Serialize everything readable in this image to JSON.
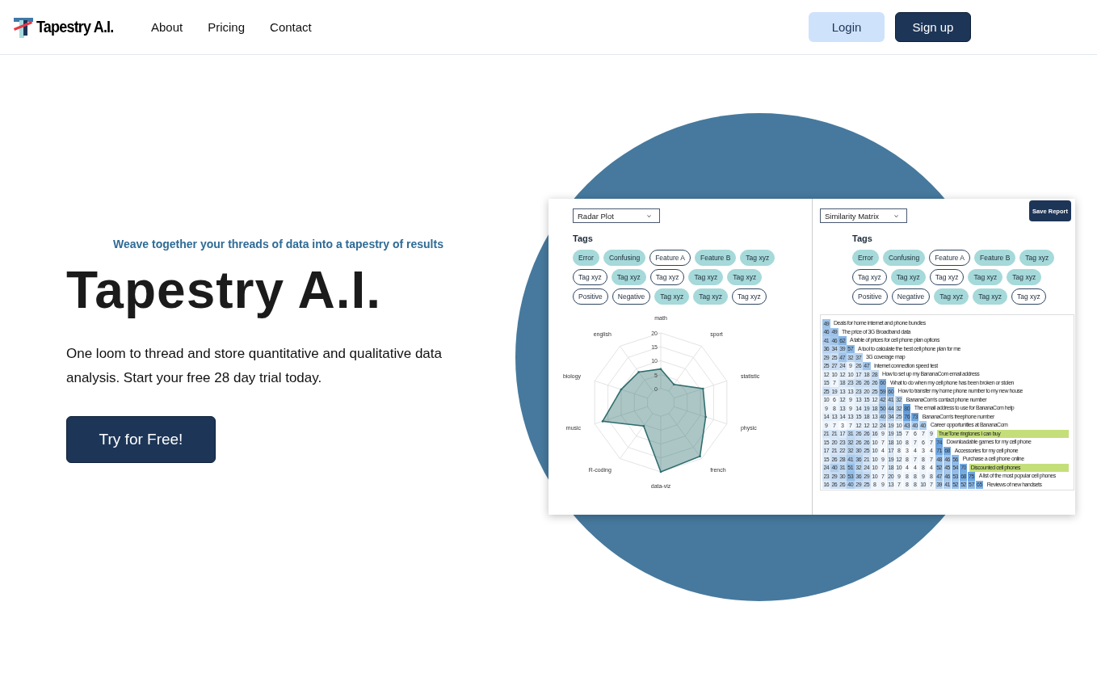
{
  "nav": {
    "brand": "Tapestry A.I.",
    "links": [
      "About",
      "Pricing",
      "Contact"
    ],
    "buttons": [
      {
        "label": "Login",
        "kind": "secondary"
      },
      {
        "label": "Sign up",
        "kind": "primary"
      }
    ]
  },
  "hero": {
    "tagline": "Weave together your threads of data into a tapestry of results",
    "title": "Tapestry A.I.",
    "description": "One loom to thread and store quantitative and qualitative data analysis. Start your free 28 day trial today.",
    "cta": "Try for Free!"
  },
  "report": {
    "save_button": "Save Report",
    "panels": [
      {
        "kind": "radar",
        "dropdown": "Radar Plot",
        "tags_label": "Tags",
        "tag_rows": [
          [
            {
              "label": "Error",
              "selected": true
            },
            {
              "label": "Confusing",
              "selected": true
            },
            {
              "label": "Feature A",
              "selected": false
            },
            {
              "label": "Feature B",
              "selected": true
            },
            {
              "label": "Tag xyz",
              "selected": true
            }
          ],
          [
            {
              "label": "Tag xyz",
              "selected": false
            },
            {
              "label": "Tag xyz",
              "selected": true
            },
            {
              "label": "Tag xyz",
              "selected": false
            },
            {
              "label": "Tag xyz",
              "selected": true
            },
            {
              "label": "Tag xyz",
              "selected": true
            }
          ],
          [
            {
              "label": "Positive",
              "selected": false
            },
            {
              "label": "Negative",
              "selected": false
            },
            {
              "label": "Tag xyz",
              "selected": true
            },
            {
              "label": "Tag xyz",
              "selected": true
            },
            {
              "label": "Tag xyz",
              "selected": false
            }
          ]
        ],
        "chart_data": {
          "type": "radar",
          "categories": [
            "math",
            "sport",
            "statistic",
            "physic",
            "french",
            "data-viz",
            "R-coding",
            "music",
            "biology",
            "english"
          ],
          "ylim": [
            -5,
            20
          ],
          "yticks": [
            0,
            5,
            10,
            15,
            20
          ],
          "series": [
            {
              "color": "#2f6e6e",
              "values": [
                7,
                3,
                11,
                12,
                19,
                20,
                5.5,
                17,
                10,
                8.5
              ]
            }
          ]
        }
      },
      {
        "kind": "matrix",
        "dropdown": "Similarity Matrix",
        "tags_label": "Tags",
        "tag_rows": [
          [
            {
              "label": "Error",
              "selected": true
            },
            {
              "label": "Confusing",
              "selected": true
            },
            {
              "label": "Feature A",
              "selected": false
            },
            {
              "label": "Feature B",
              "selected": true
            },
            {
              "label": "Tag xyz",
              "selected": true
            }
          ],
          [
            {
              "label": "Tag xyz",
              "selected": false
            },
            {
              "label": "Tag xyz",
              "selected": true
            },
            {
              "label": "Tag xyz",
              "selected": false
            },
            {
              "label": "Tag xyz",
              "selected": true
            },
            {
              "label": "Tag xyz",
              "selected": true
            }
          ],
          [
            {
              "label": "Positive",
              "selected": false
            },
            {
              "label": "Negative",
              "selected": false
            },
            {
              "label": "Tag xyz",
              "selected": true
            },
            {
              "label": "Tag xyz",
              "selected": true
            },
            {
              "label": "Tag xyz",
              "selected": false
            }
          ]
        ],
        "matrix": {
          "rows": [
            {
              "values": [
                "49"
              ],
              "label": "Deals for home internet and phone bundles",
              "highlighted": false
            },
            {
              "values": [
                "46",
                "49"
              ],
              "label": "The price of 3G Broadband data",
              "highlighted": false
            },
            {
              "values": [
                "41",
                "46",
                "62"
              ],
              "label": "A table of prices for cell phone plan options",
              "highlighted": false
            },
            {
              "values": [
                "36",
                "34",
                "39",
                "57"
              ],
              "label": "A tool to calculate the best cell phone plan for me",
              "highlighted": false
            },
            {
              "values": [
                "29",
                "25",
                "47",
                "32",
                "37"
              ],
              "label": "3G coverage map",
              "highlighted": false
            },
            {
              "values": [
                "25",
                "27",
                "24",
                "9",
                "26",
                "47"
              ],
              "label": "Internet connection speed test",
              "highlighted": false
            },
            {
              "values": [
                "12",
                "10",
                "12",
                "10",
                "17",
                "18",
                "28"
              ],
              "label": "How to set up my BananaCom email address",
              "highlighted": false
            },
            {
              "values": [
                "15",
                "7",
                "18",
                "23",
                "26",
                "26",
                "26",
                "60"
              ],
              "label": "What to do when my cell phone has been broken or stolen",
              "highlighted": false
            },
            {
              "values": [
                "25",
                "19",
                "13",
                "13",
                "23",
                "20",
                "25",
                "59",
                "60"
              ],
              "label": "How to transfer my home phone number to my new house",
              "highlighted": false
            },
            {
              "values": [
                "10",
                "6",
                "12",
                "9",
                "13",
                "15",
                "12",
                "42",
                "41",
                "32"
              ],
              "label": "BananaCom's contact phone number",
              "highlighted": false
            },
            {
              "values": [
                "9",
                "8",
                "13",
                "9",
                "14",
                "19",
                "18",
                "50",
                "44",
                "32",
                "80"
              ],
              "label": "The email address to use for BananaCom help",
              "highlighted": false
            },
            {
              "values": [
                "14",
                "13",
                "14",
                "13",
                "15",
                "18",
                "13",
                "40",
                "34",
                "25",
                "76",
                "73"
              ],
              "label": "BananaCom's freephone number",
              "highlighted": false
            },
            {
              "values": [
                "9",
                "7",
                "3",
                "7",
                "12",
                "12",
                "12",
                "24",
                "19",
                "10",
                "43",
                "40",
                "40"
              ],
              "label": "Career opportunities at BananaCom",
              "highlighted": false
            },
            {
              "values": [
                "21",
                "21",
                "17",
                "31",
                "26",
                "26",
                "16",
                "9",
                "19",
                "15",
                "7",
                "6",
                "7",
                "9"
              ],
              "label": "TrueTone ringtones I can buy",
              "highlighted": true
            },
            {
              "values": [
                "15",
                "20",
                "23",
                "32",
                "26",
                "26",
                "10",
                "7",
                "18",
                "10",
                "8",
                "7",
                "6",
                "7",
                "74"
              ],
              "label": "Downloadable games for my cell phone",
              "highlighted": false
            },
            {
              "values": [
                "17",
                "21",
                "22",
                "32",
                "30",
                "25",
                "10",
                "4",
                "17",
                "8",
                "3",
                "4",
                "3",
                "4",
                "71",
                "68"
              ],
              "label": "Accessories for my cell phone",
              "highlighted": false
            },
            {
              "values": [
                "15",
                "26",
                "28",
                "41",
                "36",
                "21",
                "10",
                "9",
                "19",
                "12",
                "8",
                "7",
                "8",
                "7",
                "48",
                "46",
                "56"
              ],
              "label": "Purchase a cell phone online",
              "highlighted": false
            },
            {
              "values": [
                "24",
                "40",
                "31",
                "51",
                "32",
                "24",
                "10",
                "7",
                "18",
                "10",
                "4",
                "4",
                "8",
                "4",
                "52",
                "45",
                "54",
                "70"
              ],
              "label": "Discounted cell phones",
              "highlighted": true
            },
            {
              "values": [
                "23",
                "29",
                "30",
                "53",
                "36",
                "29",
                "10",
                "7",
                "20",
                "9",
                "8",
                "8",
                "9",
                "8",
                "47",
                "46",
                "53",
                "68",
                "75"
              ],
              "label": "A list of the most popular cell phones",
              "highlighted": false
            },
            {
              "values": [
                "16",
                "26",
                "26",
                "40",
                "29",
                "25",
                "8",
                "9",
                "13",
                "7",
                "8",
                "8",
                "10",
                "7",
                "39",
                "41",
                "52",
                "52",
                "57",
                "65"
              ],
              "label": "Reviews of new handsets",
              "highlighted": false
            }
          ]
        }
      }
    ]
  }
}
